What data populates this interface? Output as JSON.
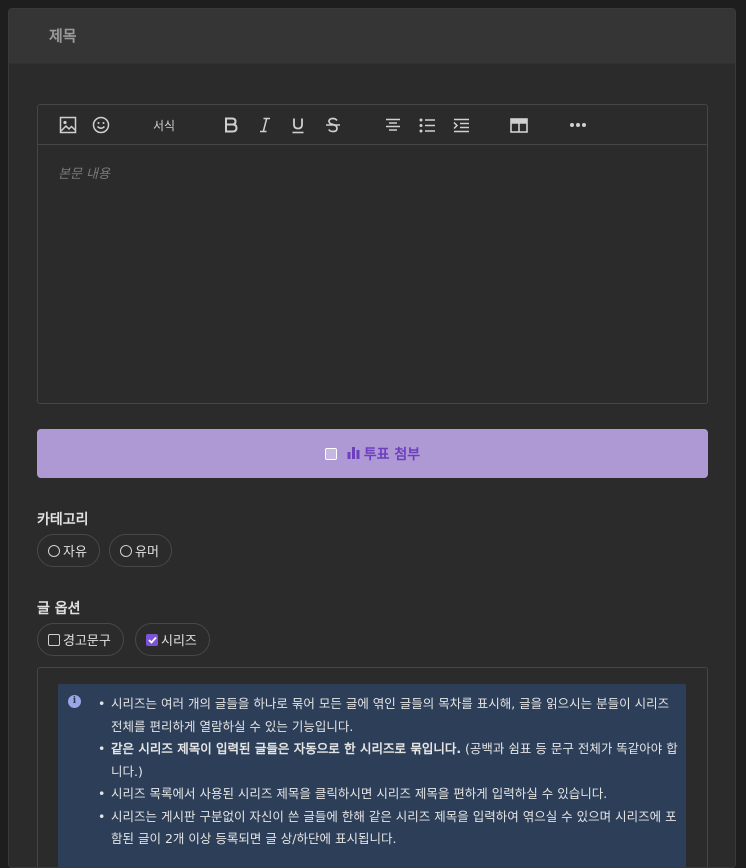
{
  "title": {
    "placeholder": "제목"
  },
  "toolbar": {
    "items": [
      "image-icon",
      "emoji-icon",
      "format-dropdown",
      "bold-icon",
      "italic-icon",
      "underline-icon",
      "strikethrough-icon",
      "align-center-icon",
      "bullet-list-icon",
      "indent-icon",
      "table-icon",
      "more-icon"
    ],
    "format_label": "서식"
  },
  "editor": {
    "placeholder": "본문 내용"
  },
  "poll": {
    "label": "투표 첨부",
    "icon": "bar-chart-icon",
    "accent": "#6c3fbf",
    "background": "#ae99d4"
  },
  "category": {
    "label": "카테고리",
    "options": [
      "자유",
      "유머"
    ]
  },
  "post_options": {
    "label": "글 옵션",
    "options": [
      {
        "label": "경고문구",
        "checked": false
      },
      {
        "label": "시리즈",
        "checked": true
      }
    ]
  },
  "series_info": {
    "items": [
      {
        "text": "시리즈는 여러 개의 글들을 하나로 묶어 모든 글에 엮인 글들의 목차를 표시해, 글을 읽으시는 분들이 시리즈 전체를 편리하게 열람하실 수 있는 기능입니다."
      },
      {
        "bold": "같은 시리즈 제목이 입력된 글들은 자동으로 한 시리즈로 묶입니다.",
        "text": " (공백과 쉼표 등 문구 전체가 똑같아야 합니다.)"
      },
      {
        "text": "시리즈 목록에서 사용된 시리즈 제목을 클릭하시면 시리즈 제목을 편하게 입력하실 수 있습니다."
      },
      {
        "text": "시리즈는 게시판 구분없이 자신이 쓴 글들에 한해 같은 시리즈 제목을 입력하여 엮으실 수 있으며 시리즈에 포함된 글이 2개 이상 등록되면 글 상/하단에 표시됩니다."
      }
    ]
  }
}
